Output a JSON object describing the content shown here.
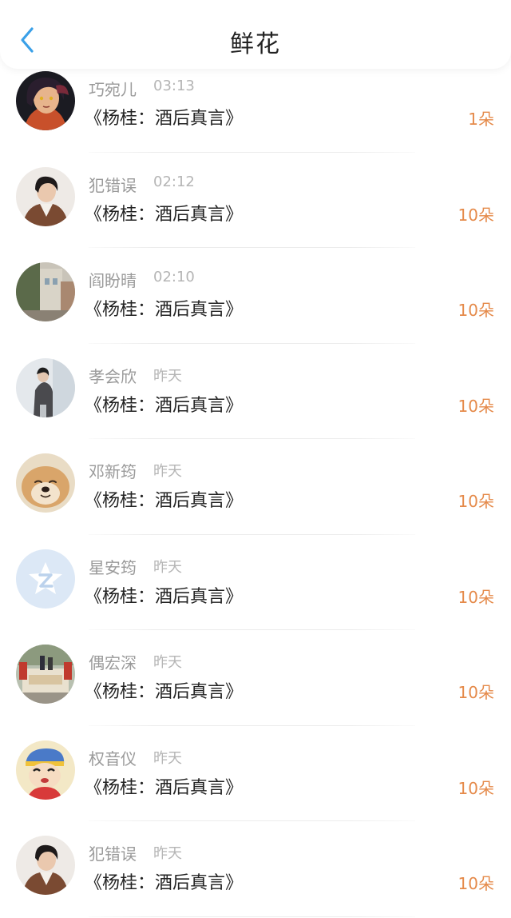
{
  "header": {
    "title": "鲜花",
    "back_icon": "chevron-left-icon",
    "accent_color": "#3aa0e8"
  },
  "colors": {
    "count": "#e58a4a",
    "name": "#9a9a9a",
    "time": "#b5b5b5",
    "message": "#222222"
  },
  "items": [
    {
      "name": "巧宛儿",
      "time": "03:13",
      "message": "《杨桂：酒后真言》",
      "count": "1朵",
      "avatar": "avatar-anime-girl-icon"
    },
    {
      "name": "犯错误",
      "time": "02:12",
      "message": "《杨桂：酒后真言》",
      "count": "10朵",
      "avatar": "avatar-man-brown-jacket-icon"
    },
    {
      "name": "阎盼晴",
      "time": "02:10",
      "message": "《杨桂：酒后真言》",
      "count": "10朵",
      "avatar": "avatar-street-photo-icon"
    },
    {
      "name": "孝会欣",
      "time": "昨天",
      "message": "《杨桂：酒后真言》",
      "count": "10朵",
      "avatar": "avatar-person-grey-icon"
    },
    {
      "name": "邓新筠",
      "time": "昨天",
      "message": "《杨桂：酒后真言》",
      "count": "10朵",
      "avatar": "avatar-dog-icon"
    },
    {
      "name": "星安筠",
      "time": "昨天",
      "message": "《杨桂：酒后真言》",
      "count": "10朵",
      "avatar": "avatar-default-z-icon"
    },
    {
      "name": "偶宏深",
      "time": "昨天",
      "message": "《杨桂：酒后真言》",
      "count": "10朵",
      "avatar": "avatar-gate-photo-icon"
    },
    {
      "name": "权音仪",
      "time": "昨天",
      "message": "《杨桂：酒后真言》",
      "count": "10朵",
      "avatar": "avatar-cartoon-boy-icon"
    },
    {
      "name": "犯错误",
      "time": "昨天",
      "message": "《杨桂：酒后真言》",
      "count": "10朵",
      "avatar": "avatar-man-brown-jacket-icon"
    }
  ]
}
